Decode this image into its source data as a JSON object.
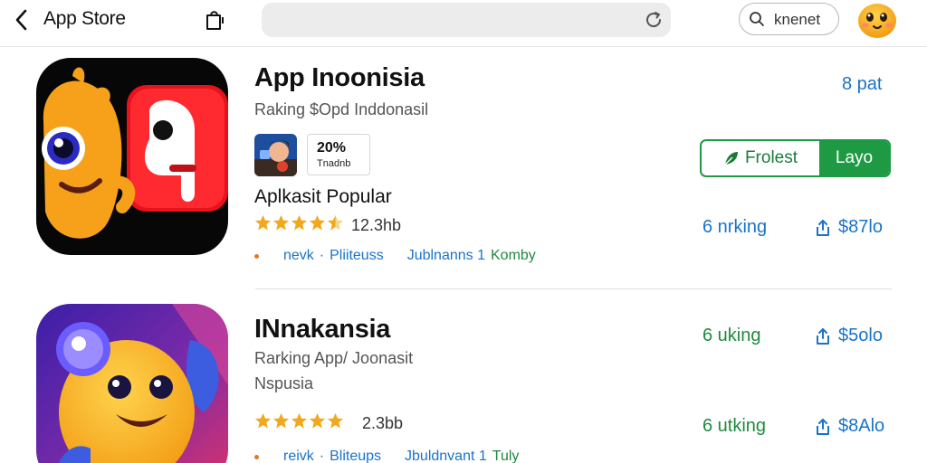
{
  "header": {
    "back_label": "<",
    "title": "App Store",
    "search_value": "",
    "account_label": "knenet"
  },
  "apps": [
    {
      "name": "App Inoonisia",
      "subtitle": "Raking $Opd Inddonasil",
      "price": "8 pat",
      "badge_percent": "20%",
      "badge_sub": "Tnadnb",
      "category": "Aplkasit Popular",
      "stars": 4.5,
      "rating_count": "12.3hb",
      "meta": [
        "nevk",
        "·",
        "Pliiteuss",
        "Jublnanns 1",
        "Komby"
      ],
      "actions": {
        "left": "Frolest",
        "right": "Layo"
      },
      "stat_left": "6 nrking",
      "stat_right": "$87lo"
    },
    {
      "name": "INnakansia",
      "subtitle": "Rarking App/ Joonasit",
      "subtitle2": "Nspusia",
      "stat_top_left": "6 uking",
      "stat_top_right": "$5olo",
      "stars": 5,
      "rating_count": "2.3bb",
      "meta": [
        "reivk",
        "·",
        "Bliteups",
        "Jbuldnvant 1",
        "Tuly"
      ],
      "stat_left": "6 utking",
      "stat_right": "$8Alo"
    }
  ],
  "colors": {
    "accent_blue": "#1a73c9",
    "accent_green": "#1e9a44",
    "star": "#f2a81d"
  }
}
